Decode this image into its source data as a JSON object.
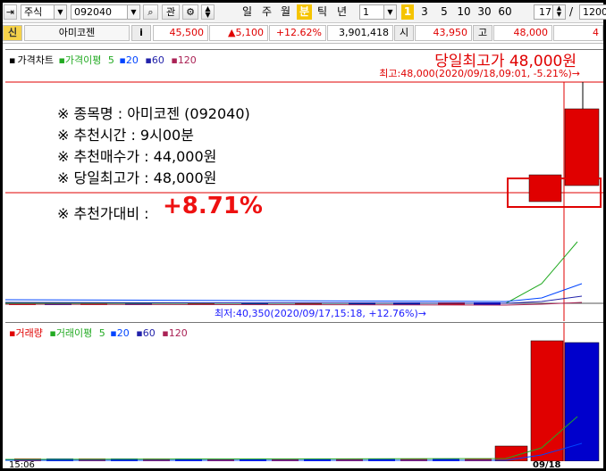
{
  "toolbar": {
    "type_select": "주식",
    "code_input": "092040",
    "btn_chart": "관",
    "periods": [
      "일",
      "주",
      "월",
      "분",
      "틱",
      "년"
    ],
    "active_period": "분",
    "minute_value": "1",
    "quick_minutes": [
      "3",
      "5",
      "10",
      "30",
      "60"
    ],
    "count_value": "17",
    "last_value": "1200"
  },
  "quote": {
    "flag": "신",
    "name": "아미코젠",
    "info_btn": "i",
    "price": "45,500",
    "change": "▲5,100",
    "change_pct": "+12.62%",
    "volume": "3,901,418",
    "open_label": "시",
    "open": "43,950",
    "high_label": "고",
    "high": "48,000",
    "extra": "4"
  },
  "price_pane": {
    "legend_title": "가격차트",
    "legend_ma": "가격이평",
    "ma_periods": [
      "5",
      "20",
      "60",
      "120"
    ],
    "title_annotation": "당일최고가 48,000원",
    "high_annotation": "최고:48,000(2020/09/18,09:01, -5.21%)→",
    "low_annotation": "최저:40,350(2020/09/17,15:18, +12.76%)→",
    "info_lines": [
      "※ 종목명 : 아미코젠 (092040)",
      "※ 추천시간 : 9시00분",
      "※ 추천매수가 : 44,000원",
      "※ 당일최고가 : 48,000원"
    ],
    "ratio_label": "※ 추천가대비 :",
    "ratio_value": "+8.71%"
  },
  "volume_pane": {
    "legend_title": "거래량",
    "legend_ma": "거래이평",
    "ma_periods": [
      "5",
      "20",
      "60",
      "120"
    ]
  },
  "x_axis": {
    "left_label": "15:06",
    "date_label": "09/18"
  },
  "colors": {
    "up": "#e00000",
    "down": "#0000cc",
    "ma5": "#22aa22",
    "ma20": "#0044ff",
    "ma60": "#2222aa",
    "ma120": "#aa2255",
    "annotation": "#e00000"
  }
}
